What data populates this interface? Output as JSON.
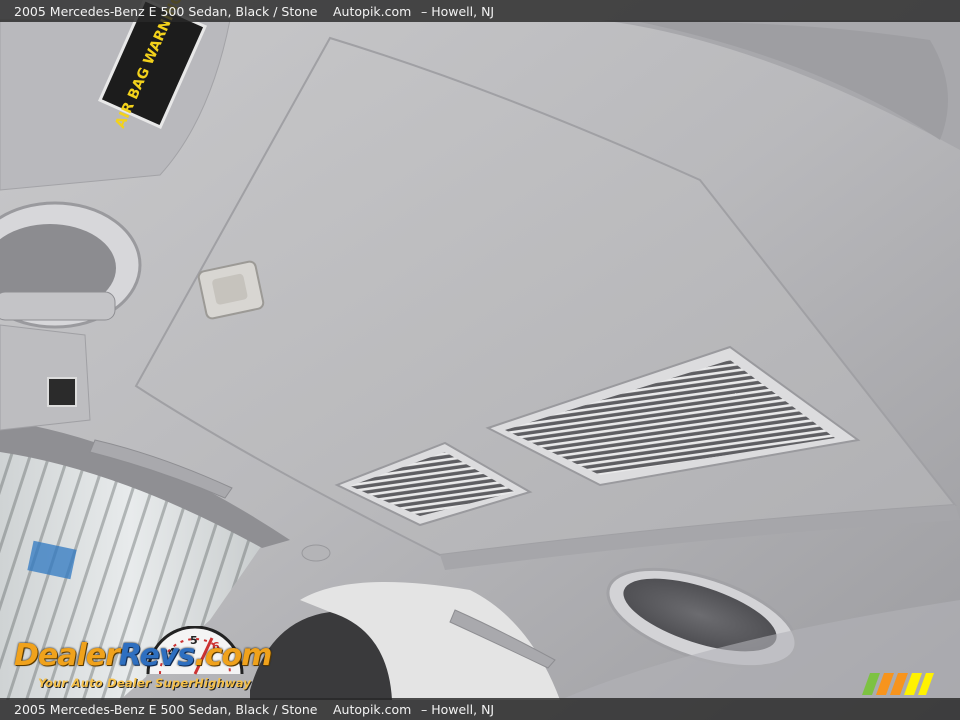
{
  "caption": {
    "title": "2005 Mercedes-Benz E 500 Sedan,  Black / Stone",
    "site": "Autopik.com",
    "location": "– Howell, NJ"
  },
  "label": {
    "text": "AIR BAG WARNING"
  },
  "logo": {
    "brand_part1": "Dealer",
    "brand_part2": "Revs",
    "brand_suffix": ".com",
    "tagline": "Your Auto Dealer SuperHighway",
    "gauge_numbers": [
      "4",
      "5",
      "6"
    ]
  }
}
